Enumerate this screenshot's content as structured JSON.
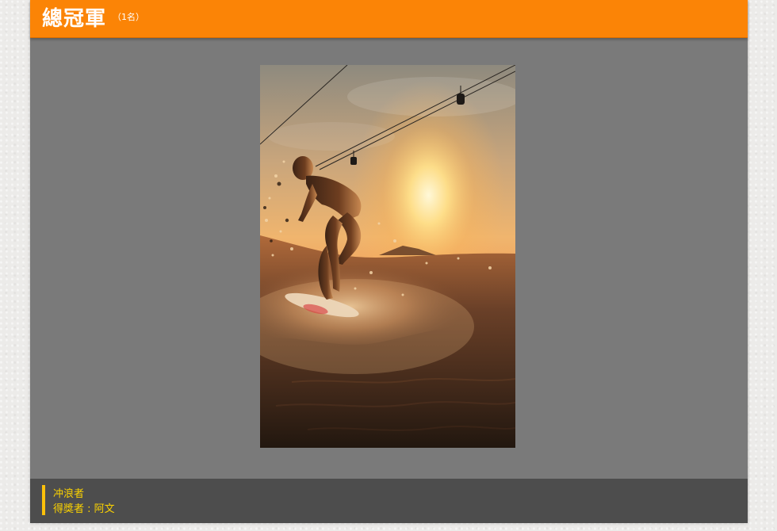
{
  "header": {
    "title": "總冠軍",
    "subtitle": "（1名）"
  },
  "photo": {
    "subject": "surfer-silhouette-at-sunset"
  },
  "caption": {
    "work_title": "冲浪者",
    "winner_line": "得獎者 : 阿文"
  },
  "colors": {
    "header_orange": "#fb8406",
    "caption_yellow": "#fbd200",
    "panel_gray": "#7a7a7a",
    "caption_bg": "#4d4d4d"
  }
}
